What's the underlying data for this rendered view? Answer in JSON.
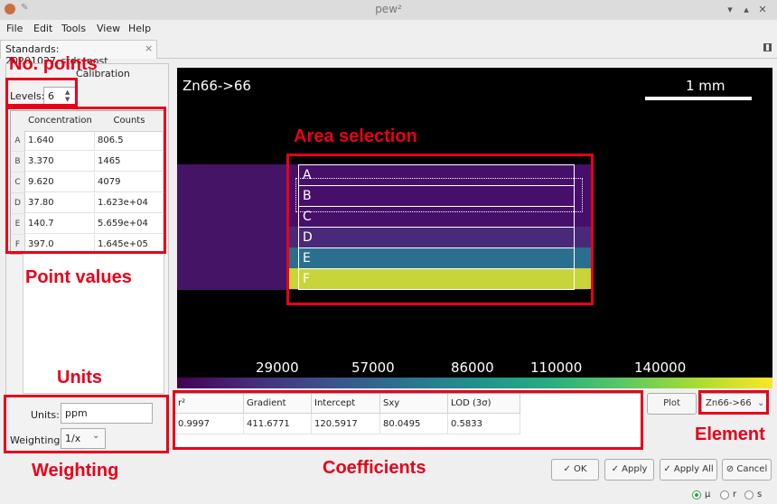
{
  "window": {
    "title": "pew²"
  },
  "menu": [
    "File",
    "Edit",
    "Tools",
    "View",
    "Help"
  ],
  "tab": {
    "label": "Standards: 20201027_stds_post",
    "close": "×"
  },
  "calibration": {
    "title": "Calibration",
    "levels_label": "Levels:",
    "levels_value": "6",
    "table": {
      "headers": [
        "Concentration",
        "Counts"
      ],
      "rows": [
        {
          "id": "A",
          "concentration": "1.640",
          "counts": "806.5"
        },
        {
          "id": "B",
          "concentration": "3.370",
          "counts": "1465"
        },
        {
          "id": "C",
          "concentration": "9.620",
          "counts": "4079"
        },
        {
          "id": "D",
          "concentration": "37.80",
          "counts": "1.623e+04"
        },
        {
          "id": "E",
          "concentration": "140.7",
          "counts": "5.659e+04"
        },
        {
          "id": "F",
          "concentration": "397.0",
          "counts": "1.645e+05"
        }
      ]
    },
    "units_label": "Units:",
    "units_value": "ppm",
    "weighting_label": "Weighting:",
    "weighting_value": "1/x"
  },
  "image": {
    "element": "Zn66->66",
    "scale_label": "1 mm",
    "selections": [
      "A",
      "B",
      "C",
      "D",
      "E",
      "F"
    ],
    "row_colors": [
      "#46106a",
      "#46106a",
      "#46106a",
      "#482a78",
      "#2b6f8e",
      "#c7d53a"
    ],
    "colorbar_ticks": [
      "29000",
      "57000",
      "86000",
      "110000",
      "140000"
    ]
  },
  "coefficients": {
    "headers": [
      "r²",
      "Gradient",
      "Intercept",
      "Sxy",
      "LOD (3σ)"
    ],
    "values": [
      "0.9997",
      "411.6771",
      "120.5917",
      "80.0495",
      "0.5833"
    ]
  },
  "controls": {
    "plot": "Plot",
    "element_select": "Zn66->66",
    "ok": "✓ OK",
    "apply": "✓ Apply",
    "apply_all": "✓ Apply All",
    "cancel": "⊘ Cancel"
  },
  "status": {
    "options": [
      "μ",
      "r",
      "s"
    ],
    "selected": "μ"
  },
  "annotations": {
    "no_points": "No. points",
    "area_selection": "Area selection",
    "point_values": "Point values",
    "units": "Units",
    "weighting": "Weighting",
    "coefficients": "Coefficients",
    "element": "Element"
  }
}
